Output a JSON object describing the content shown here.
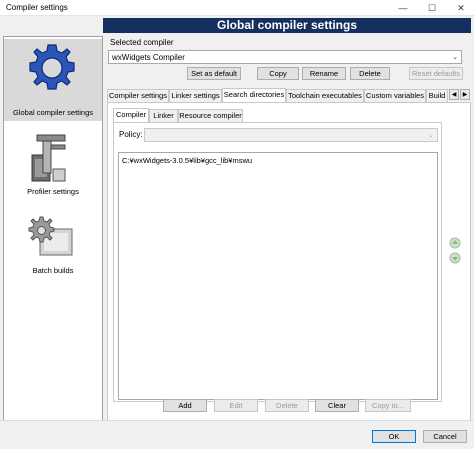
{
  "window": {
    "title": "Compiler settings",
    "min_icon": "minimize-icon",
    "max_icon": "maximize-icon",
    "close_icon": "close-icon"
  },
  "banner": {
    "title": "Global compiler settings"
  },
  "nav": {
    "items": [
      {
        "label": "Global compiler settings",
        "icon": "gear-icon",
        "selected": true
      },
      {
        "label": "Profiler settings",
        "icon": "profiler-icon",
        "selected": false
      },
      {
        "label": "Batch builds",
        "icon": "batch-builds-icon",
        "selected": false
      }
    ]
  },
  "compiler": {
    "selected_label": "Selected compiler",
    "selected_value": "wxWidgets Compiler",
    "buttons": {
      "set_default": "Set as default",
      "copy": "Copy",
      "rename": "Rename",
      "delete": "Delete",
      "reset_defaults": "Reset defaults"
    }
  },
  "tabs": [
    "Compiler settings",
    "Linker settings",
    "Search directories",
    "Toolchain executables",
    "Custom variables",
    "Build"
  ],
  "active_tab": "Search directories",
  "subtabs": [
    "Compiler",
    "Linker",
    "Resource compiler"
  ],
  "active_subtab": "Compiler",
  "policy": {
    "label": "Policy:",
    "value": ""
  },
  "directories": [
    "C:¥wxWidgets-3.0.5¥lib¥gcc_lib¥mswu"
  ],
  "actions": {
    "add": "Add",
    "edit": "Edit",
    "delete": "Delete",
    "clear": "Clear",
    "copy_to": "Copy to..."
  },
  "footer": {
    "ok": "OK",
    "cancel": "Cancel"
  },
  "colors": {
    "banner": "#15305f",
    "gear": "#2c55b8"
  }
}
